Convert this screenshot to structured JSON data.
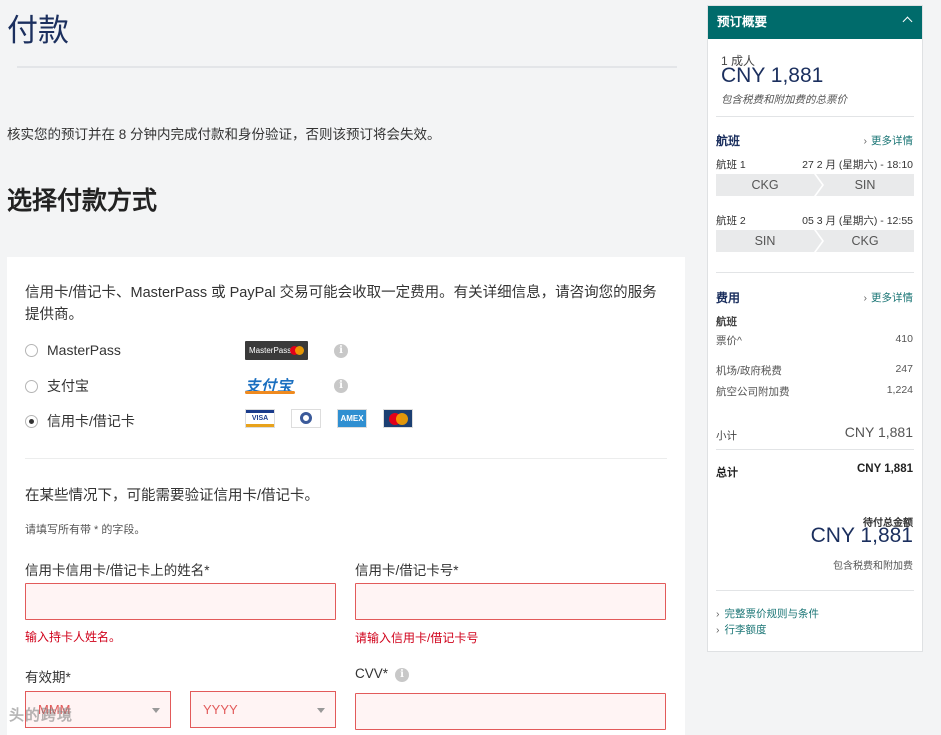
{
  "page": {
    "title": "付款",
    "notice": "核实您的预订并在 8 分钟内完成付款和身份验证，否则该预订将会失效。",
    "section_title": "选择付款方式"
  },
  "payment": {
    "fee_note": "信用卡/借记卡、MasterPass 或 PayPal 交易可能会收取一定费用。有关详细信息，请咨询您的服务提供商。",
    "methods": [
      {
        "label": "MasterPass",
        "logo": "MasterPass",
        "selected": false
      },
      {
        "label": "支付宝",
        "logo": "支付宝",
        "selected": false
      },
      {
        "label": "信用卡/借记卡",
        "selected": true
      }
    ],
    "card_logos": [
      "VISA",
      "Diners Club",
      "AMEX",
      "MasterCard"
    ],
    "verify_note": "在某些情况下，可能需要验证信用卡/借记卡。",
    "required_note": "请填写所有带 * 的字段。",
    "fields": {
      "name_label": "信用卡信用卡/借记卡上的姓名*",
      "name_error": "输入持卡人姓名。",
      "number_label": "信用卡/借记卡号*",
      "number_error": "请输入信用卡/借记卡号",
      "expiry_label": "有效期*",
      "expiry_month_placeholder": "MMM",
      "expiry_year_placeholder": "YYYY",
      "cvv_label": "CVV*"
    }
  },
  "watermark": "头的跨境",
  "summary": {
    "header": "预订概要",
    "pax": "1 成人",
    "total": "CNY 1,881",
    "total_note": "包含税费和附加费的总票价",
    "flights_title": "航班",
    "more_details": "更多详情",
    "flights": [
      {
        "label": "航班 1",
        "date": "27 2 月 (星期六) - 18:10",
        "from": "CKG",
        "to": "SIN"
      },
      {
        "label": "航班 2",
        "date": "05 3 月 (星期六) - 12:55",
        "from": "SIN",
        "to": "CKG"
      }
    ],
    "fees_title": "费用",
    "fees_more": "更多详情",
    "flight_sub": "航班",
    "fares": [
      {
        "label": "票价^",
        "value": "410"
      },
      {
        "label": "机场/政府税费",
        "value": "247"
      },
      {
        "label": "航空公司附加费",
        "value": "1,224"
      }
    ],
    "subtotal_label": "小计",
    "subtotal_value": "CNY 1,881",
    "grand_label": "总计",
    "grand_value": "CNY 1,881",
    "due_label": "待付总金额",
    "due_value": "CNY 1,881",
    "due_note": "包含税费和附加费",
    "links": [
      "完整票价规则与条件",
      "行李额度"
    ]
  },
  "colors": {
    "brand_navy": "#1b2f5e",
    "header_teal": "#006b6b",
    "error_red": "#d0021b",
    "link_teal": "#1a7575"
  }
}
